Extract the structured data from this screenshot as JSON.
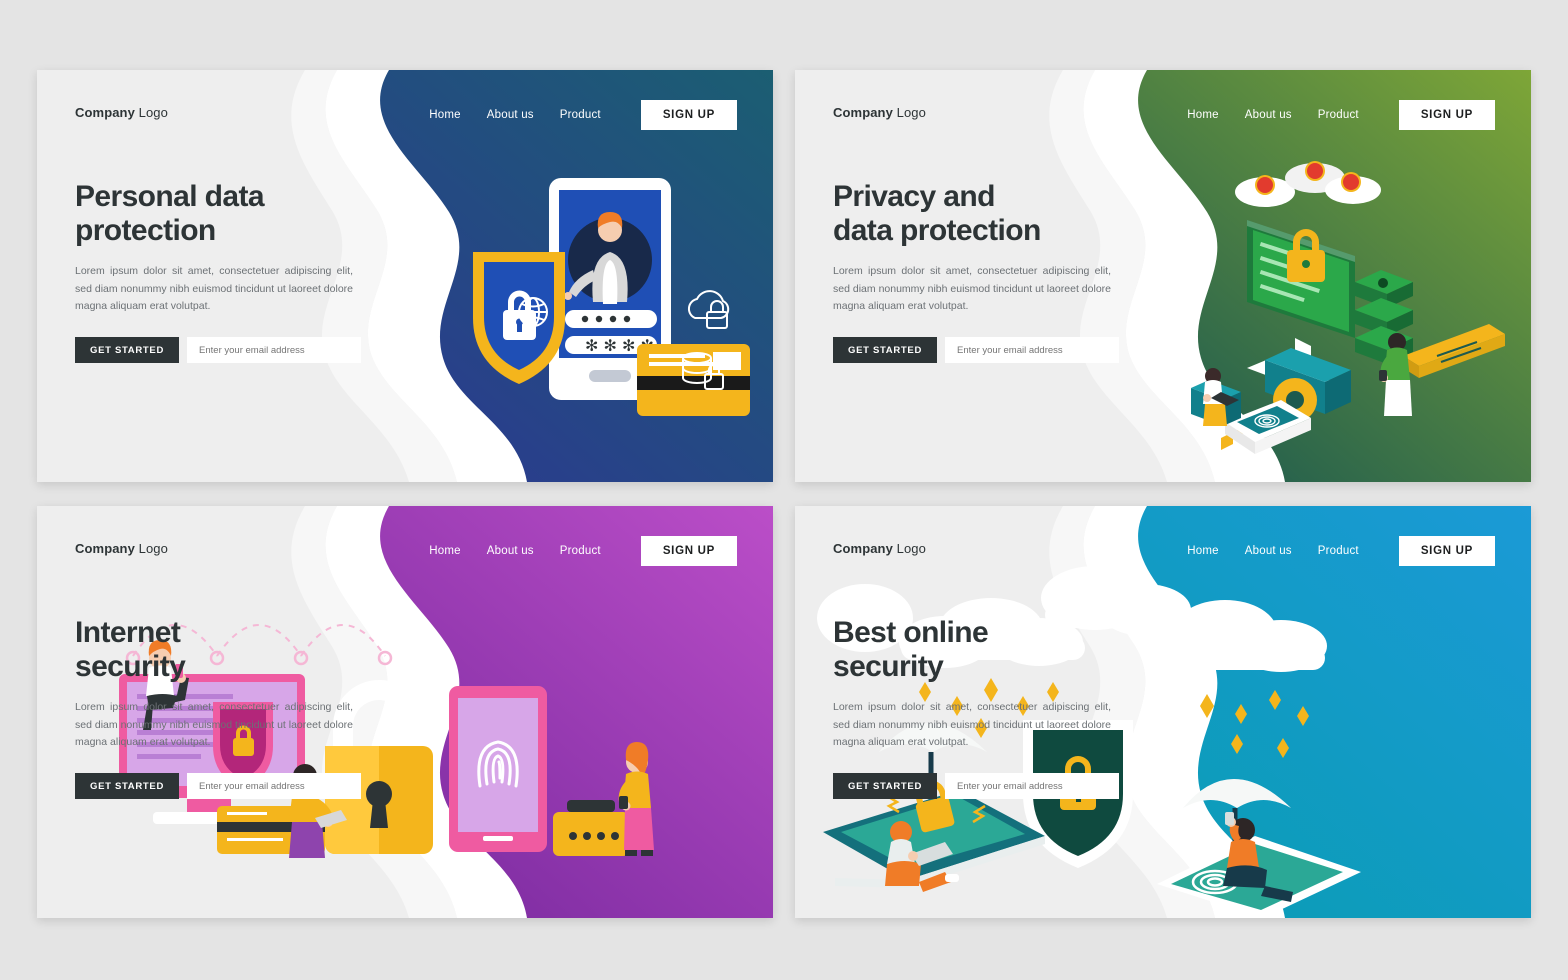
{
  "page": {
    "background": "#e4e4e4",
    "panel_background": "#eeeeee"
  },
  "shared": {
    "brand_bold": "Company",
    "brand_light": " Logo",
    "nav": [
      "Home",
      "About us",
      "Product"
    ],
    "signup_label": "SIGN UP",
    "cta_label": "GET STARTED",
    "email_placeholder": "Enter your email address",
    "body_text": "Lorem ipsum dolor sit amet, consectetuer adipiscing elit, sed diam nonummy nibh euismod tincidunt ut laoreet dolore magna aliquam erat volutpat.",
    "heading_color": "#2d3436",
    "body_color": "#6c7175",
    "button_color": "#2d3436",
    "signup_bg": "#ffffff"
  },
  "panels": [
    {
      "id": "personal-data-protection",
      "headline": "Personal data\nprotection",
      "accent_top": "#1b5e72",
      "accent_bottom": "#2b3a8f",
      "illustration": "phone-shield-card",
      "icons": [
        "globe-icon",
        "cloud-lock-icon",
        "database-lock-icon",
        "shield-lock-icon",
        "credit-card-icon",
        "password-dots",
        "password-asterisks"
      ]
    },
    {
      "id": "privacy-and-data-protection",
      "headline": "Privacy and\ndata protection",
      "accent_top": "#7ea637",
      "accent_bottom": "#1d5a4f",
      "illustration": "isometric-monitor-key-server",
      "icons": [
        "monitor-lock-icon",
        "server-stack-icon",
        "key-icon",
        "credit-card-icon",
        "fingerprint-phone-icon",
        "virus-blocked-cloud-icon"
      ]
    },
    {
      "id": "internet-security",
      "headline": "Internet\nsecurity",
      "accent_top": "#bb4ec8",
      "accent_bottom": "#7b2ba0",
      "illustration": "devices-padlock",
      "icons": [
        "monitor-icon",
        "shield-lock-icon",
        "padlock-icon",
        "fingerprint-phone-icon",
        "credit-card-icon",
        "wifi-arc-icon"
      ]
    },
    {
      "id": "best-online-security",
      "headline": "Best online\nsecurity",
      "accent_top": "#1b9ad6",
      "accent_bottom": "#0a9cb5",
      "illustration": "clouds-umbrellas-shield",
      "icons": [
        "cloud-icon",
        "umbrella-icon",
        "shield-lock-icon",
        "laptop-icon",
        "smartphone-icon",
        "rain-drop-icon"
      ]
    }
  ]
}
